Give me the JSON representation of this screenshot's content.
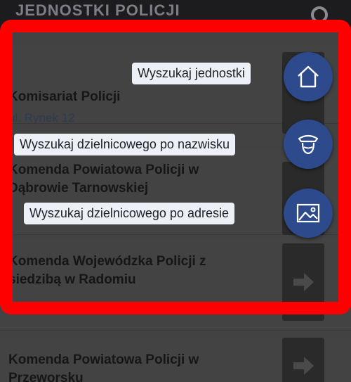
{
  "appbar": {
    "title": "JEDNOSTKI POLICJI",
    "search_icon": "search-icon"
  },
  "list": {
    "items": [
      {
        "title_line1": "Komisariat Policji",
        "title_line2": "",
        "address": "ul. Rynek 12"
      },
      {
        "title_line1": "Komenda Powiatowa Policji w",
        "title_line2": "Dąbrowie Tarnowskiej",
        "address": ""
      },
      {
        "title_line1": "Komenda Wojewódzka Policji z",
        "title_line2": "siedzibą w Radomiu",
        "address": ""
      },
      {
        "title_line1": "Komenda Powiatowa Policji w",
        "title_line2": "Przeworsku",
        "address": ""
      }
    ]
  },
  "fab_menu": {
    "items": [
      {
        "label": "Wyszukaj jednostki",
        "icon": "house-icon"
      },
      {
        "label": "Wyszukaj dzielnicowego po nazwisku",
        "icon": "police-officer-icon"
      },
      {
        "label": "Wyszukaj dzielnicowego po adresie",
        "icon": "image-icon"
      }
    ]
  },
  "colors": {
    "frame": "#ff0000",
    "fab": "#2c4a8c",
    "label_bg": "#eef0f7"
  }
}
